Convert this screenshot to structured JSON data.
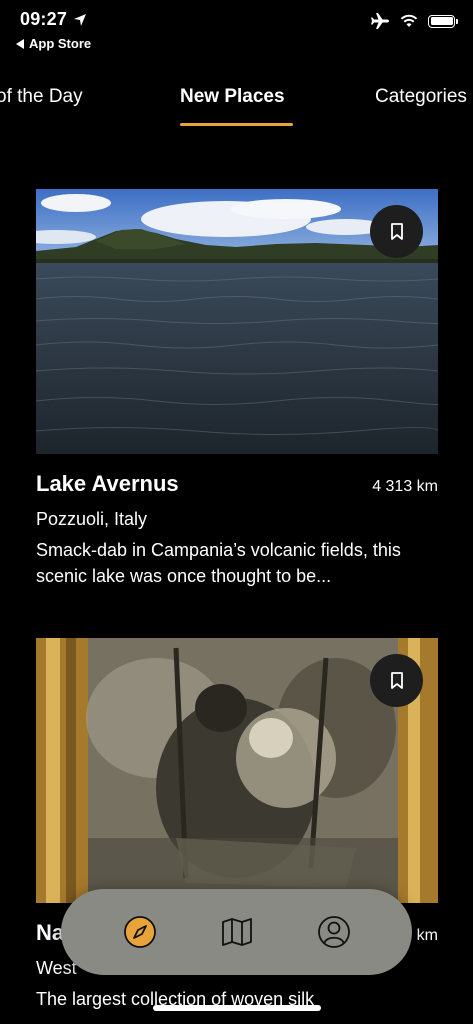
{
  "status": {
    "time": "09:27",
    "back_app": "App Store"
  },
  "tabs": [
    {
      "label": "of the Day"
    },
    {
      "label": "New Places"
    },
    {
      "label": "Categories"
    }
  ],
  "cards": [
    {
      "title": "Lake Avernus",
      "distance": "4 313 km",
      "location": "Pozzuoli, Italy",
      "description": "Smack-dab in Campania’s volcanic fields, this scenic lake was once thought to be..."
    },
    {
      "title": "Na",
      "distance": "km",
      "location": "West",
      "description": "The largest collection of woven silk"
    }
  ],
  "colors": {
    "accent": "#e8a33a",
    "nav_bg": "#8a8a84"
  },
  "icons": {
    "nav": [
      "compass-icon",
      "map-icon",
      "profile-icon"
    ]
  }
}
